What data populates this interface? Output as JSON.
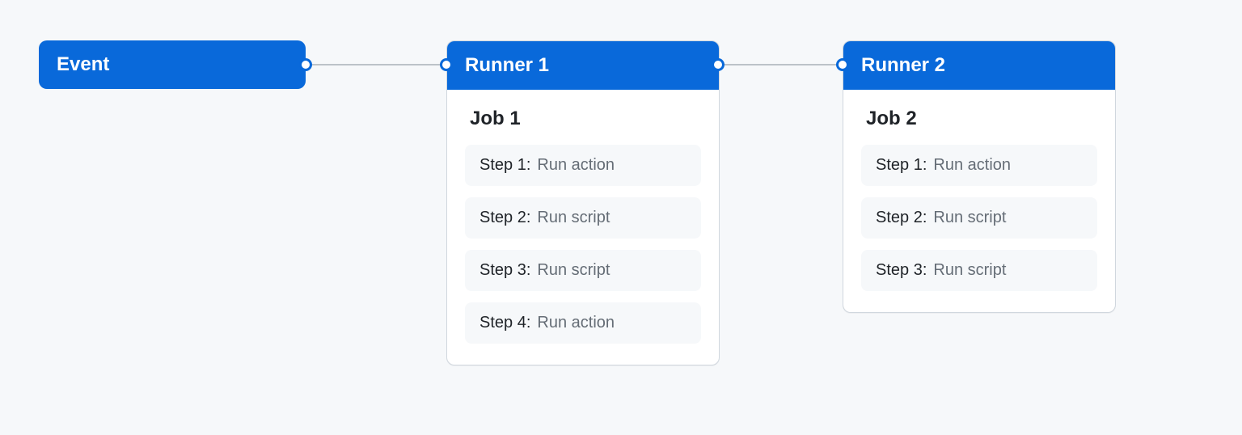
{
  "event": {
    "label": "Event"
  },
  "runners": [
    {
      "header": "Runner 1",
      "job_title": "Job 1",
      "steps": [
        {
          "label": "Step 1:",
          "desc": "Run action"
        },
        {
          "label": "Step 2:",
          "desc": "Run script"
        },
        {
          "label": "Step 3:",
          "desc": "Run script"
        },
        {
          "label": "Step 4:",
          "desc": "Run action"
        }
      ]
    },
    {
      "header": "Runner 2",
      "job_title": "Job 2",
      "steps": [
        {
          "label": "Step 1:",
          "desc": "Run action"
        },
        {
          "label": "Step 2:",
          "desc": "Run script"
        },
        {
          "label": "Step 3:",
          "desc": "Run script"
        }
      ]
    }
  ]
}
